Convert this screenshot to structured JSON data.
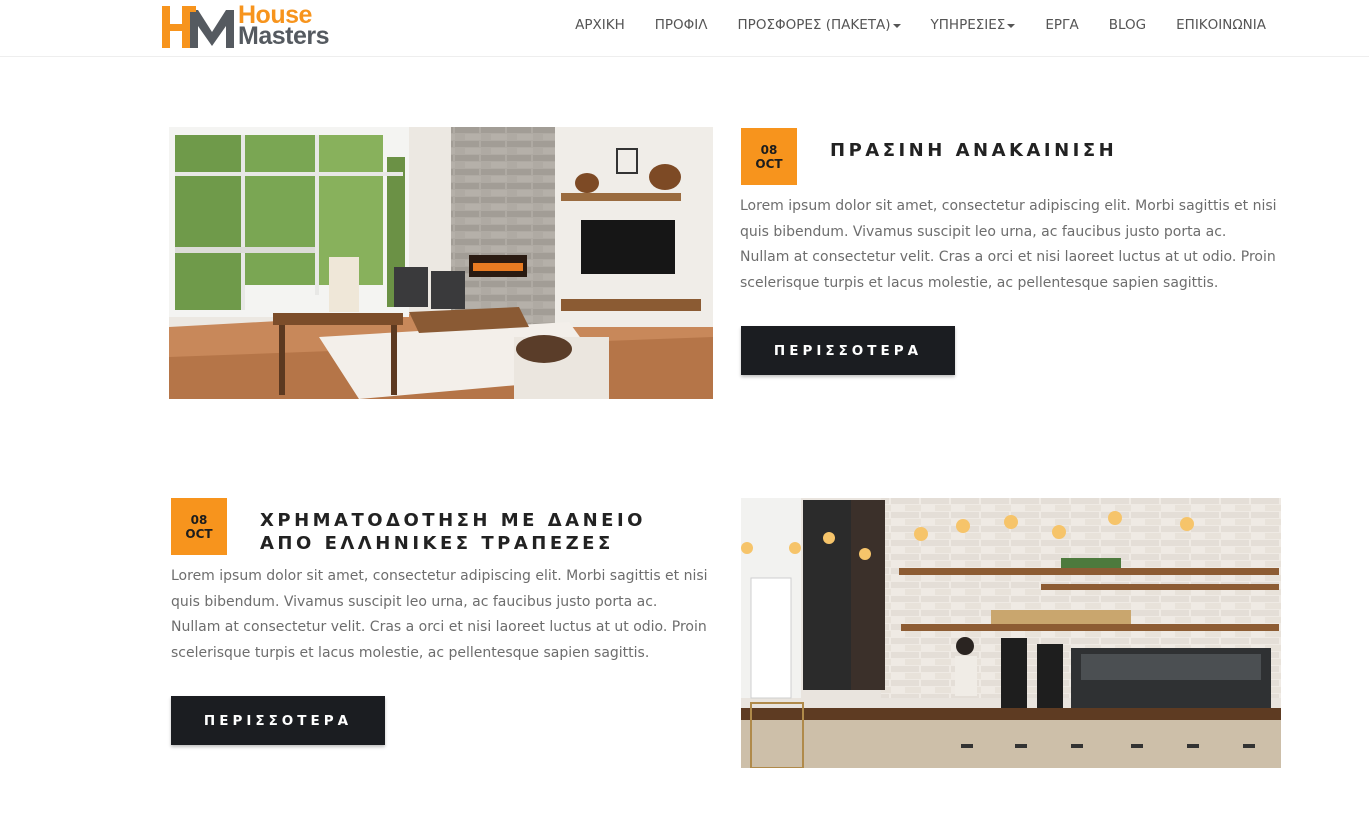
{
  "brand": {
    "logo_line1": "House",
    "logo_line2": "Masters",
    "accent_color": "#f7941d",
    "dark_color": "#555a60"
  },
  "nav": {
    "items": [
      {
        "label": "ΑΡΧΙΚΗ",
        "dropdown": false
      },
      {
        "label": "ΠΡΟΦΙΛ",
        "dropdown": false
      },
      {
        "label": "ΠΡΟΣΦΟΡΕΣ (ΠΑΚΕΤΑ)",
        "dropdown": true
      },
      {
        "label": "ΥΠΗΡΕΣΙΕΣ",
        "dropdown": true
      },
      {
        "label": "ΕΡΓΑ",
        "dropdown": false
      },
      {
        "label": "BLOG",
        "dropdown": false
      },
      {
        "label": "ΕΠΙΚΟΙΝΩΝΙΑ",
        "dropdown": false
      }
    ]
  },
  "posts": [
    {
      "day": "08",
      "month": "OCT",
      "title_line1": "ΠΡΑΣΙΝΗ ΑΝΑΚΑΙΝΙΣΗ",
      "title_line2": "",
      "text": "Lorem ipsum dolor sit amet, consectetur adipiscing elit. Morbi sagittis et nisi quis bibendum. Vivamus suscipit leo urna, ac faucibus justo porta ac. Nullam at consectetur velit. Cras a orci et nisi laoreet luctus at ut odio. Proin scelerisque turpis et lacus molestie, ac pellentesque sapien sagittis.",
      "button": "ΠΕΡΙΣΣΟΤΕΡΑ",
      "image": "living-room-photo"
    },
    {
      "day": "08",
      "month": "OCT",
      "title_line1": "ΧΡΗΜΑΤΟΔΟΤΗΣΗ ΜΕ ΔΑΝΕΙΟ",
      "title_line2": "ΑΠΟ ΕΛΛΗΝΙΚΕΣ ΤΡΑΠΕΖΕΣ",
      "text": "Lorem ipsum dolor sit amet, consectetur adipiscing elit. Morbi sagittis et nisi quis bibendum. Vivamus suscipit leo urna, ac faucibus justo porta ac. Nullam at consectetur velit. Cras a orci et nisi laoreet luctus at ut odio. Proin scelerisque turpis et lacus molestie, ac pellentesque sapien sagittis.",
      "button": "ΠΕΡΙΣΣΟΤΕΡΑ",
      "image": "cafe-counter-photo"
    }
  ]
}
